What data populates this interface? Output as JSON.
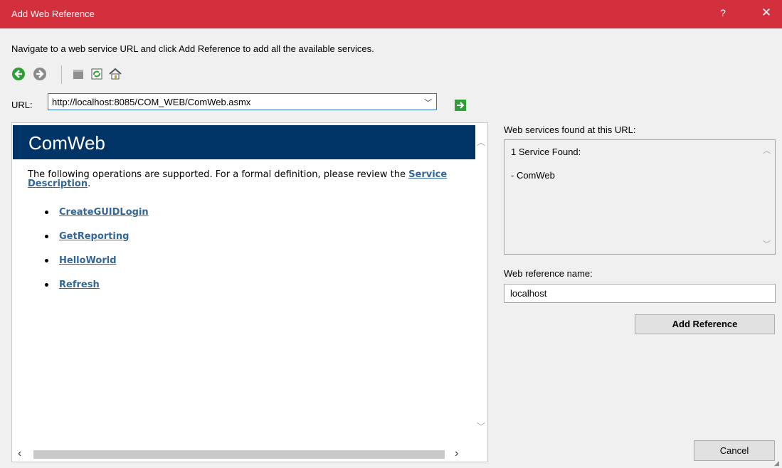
{
  "window": {
    "title": "Add Web Reference",
    "help_label": "?",
    "close_label": "✕"
  },
  "instruction": "Navigate to a web service URL and click Add Reference to add all the available services.",
  "toolbar": {
    "icons": [
      "back-icon",
      "forward-icon",
      "stop-icon",
      "refresh-icon",
      "home-icon"
    ],
    "colors": {
      "nav_green": "#2e9e35",
      "nav_gray": "#8a8a8a"
    }
  },
  "url": {
    "label": "URL:",
    "value": "http://localhost:8085/COM_WEB/ComWeb.asmx",
    "dropdown_glyph": "﹀",
    "go_icon": "go-arrow-icon"
  },
  "browser": {
    "service_name": "ComWeb",
    "banner_color": "#003366",
    "description_prefix": "The following operations are supported. For a formal definition, please review the ",
    "description_link": "Service Description",
    "description_suffix": ".",
    "operations": [
      "CreateGUIDLogin",
      "GetReporting",
      "HelloWorld",
      "Refresh"
    ],
    "link_color": "#336699"
  },
  "services": {
    "label": "Web services found at this URL:",
    "count_text": "1 Service Found:",
    "item": "- ComWeb"
  },
  "reference": {
    "label": "Web reference name:",
    "value": "localhost"
  },
  "buttons": {
    "add_reference": "Add Reference",
    "cancel": "Cancel"
  },
  "colors": {
    "titlebar": "#d32f3d",
    "dialog_bg": "#f0f0f0",
    "url_border": "#2c73d2"
  }
}
